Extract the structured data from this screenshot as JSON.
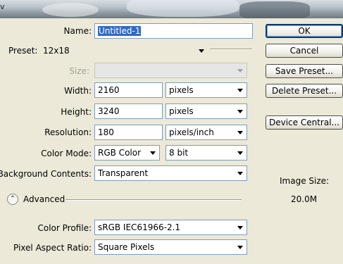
{
  "window": {
    "title_fragment": "v"
  },
  "form": {
    "name": {
      "label": "Name:",
      "value": "Untitled-1"
    },
    "preset": {
      "label": "Preset:",
      "value": "12x18"
    },
    "size": {
      "label": "Size:",
      "value": ""
    },
    "width": {
      "label": "Width:",
      "value": "2160",
      "unit": "pixels"
    },
    "height": {
      "label": "Height:",
      "value": "3240",
      "unit": "pixels"
    },
    "resolution": {
      "label": "Resolution:",
      "value": "180",
      "unit": "pixels/inch"
    },
    "color_mode": {
      "label": "Color Mode:",
      "value": "RGB Color",
      "depth": "8 bit"
    },
    "background": {
      "label": "Background Contents:",
      "value": "Transparent"
    },
    "advanced": {
      "label": "Advanced"
    },
    "color_profile": {
      "label": "Color Profile:",
      "value": "sRGB IEC61966-2.1"
    },
    "pixel_aspect": {
      "label": "Pixel Aspect Ratio:",
      "value": "Square Pixels"
    }
  },
  "buttons": {
    "ok": "OK",
    "cancel": "Cancel",
    "save_preset": "Save Preset...",
    "delete_preset": "Delete Preset...",
    "device_central": "Device Central..."
  },
  "image_size": {
    "label": "Image Size:",
    "value": "20.0M"
  }
}
